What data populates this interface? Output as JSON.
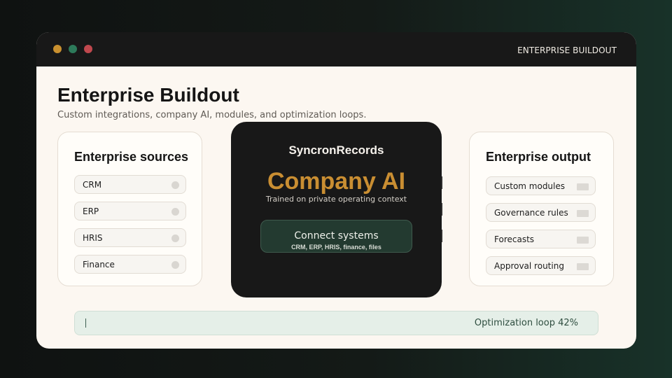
{
  "window": {
    "title": "ENTERPRISE BUILDOUT",
    "controls": [
      {
        "name": "dot-amber",
        "color": "#c9902f"
      },
      {
        "name": "dot-green",
        "color": "#2d7a5a"
      },
      {
        "name": "dot-red",
        "color": "#c0484e"
      }
    ]
  },
  "header": {
    "title": "Enterprise Buildout",
    "subtitle": "Custom integrations, company AI, modules, and optimization loops."
  },
  "sources": {
    "title": "Enterprise sources",
    "items": [
      {
        "label": "CRM",
        "icon": "status-dot"
      },
      {
        "label": "ERP",
        "icon": "status-dot"
      },
      {
        "label": "HRIS",
        "icon": "status-dot"
      },
      {
        "label": "Finance",
        "icon": "status-dot"
      }
    ]
  },
  "center": {
    "brand": "SyncronRecords",
    "headline": "Company AI",
    "subtitle": "Trained on private operating context",
    "connect": {
      "label": "Connect systems",
      "detail": "CRM, ERP, HRIS, finance, files"
    }
  },
  "output": {
    "title": "Enterprise output",
    "items": [
      {
        "label": "Custom modules",
        "icon": "status-bar"
      },
      {
        "label": "Governance rules",
        "icon": "status-bar"
      },
      {
        "label": "Forecasts",
        "icon": "status-bar"
      },
      {
        "label": "Approval routing",
        "icon": "status-bar"
      }
    ]
  },
  "progress": {
    "label": "Optimization loop 42%",
    "value_percent": 42
  },
  "colors": {
    "accent": "#c98e32",
    "panel_dark": "#181818",
    "connect_bg": "#233a30",
    "progress_bg": "#e5efe8"
  }
}
